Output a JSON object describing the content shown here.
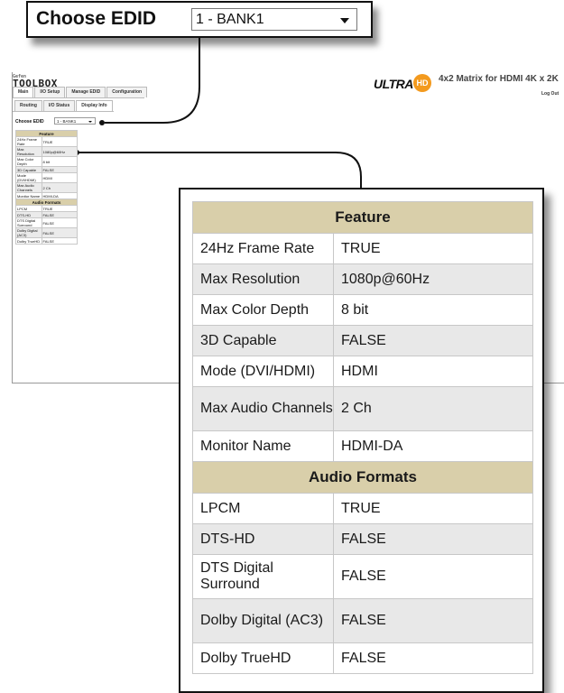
{
  "callout": {
    "label": "Choose EDID",
    "selected": "1 - BANK1"
  },
  "app": {
    "logo_small": "Gefen",
    "logo_main": "TOOLBOX",
    "brand_ultra": "ULTRA",
    "brand_hd": "HD",
    "title": "4x2 Matrix for HDMI 4K x 2K",
    "logout": "Log Out"
  },
  "tabs_main": [
    "Main",
    "I/O Setup",
    "Manage EDID",
    "Configuration"
  ],
  "tabs_sub": [
    "Routing",
    "I/O Status",
    "Display Info"
  ],
  "mini": {
    "choose_label": "Choose EDID",
    "selected": "1 - BANK1"
  },
  "table": {
    "feature_header": "Feature",
    "audio_header": "Audio Formats",
    "features": [
      {
        "key": "24Hz Frame Rate",
        "value": "TRUE"
      },
      {
        "key": "Max Resolution",
        "value": "1080p@60Hz"
      },
      {
        "key": "Max Color Depth",
        "value": "8 bit"
      },
      {
        "key": "3D Capable",
        "value": "FALSE"
      },
      {
        "key": "Mode (DVI/HDMI)",
        "value": "HDMI"
      },
      {
        "key": "Max Audio Channels",
        "value": "2 Ch"
      },
      {
        "key": "Monitor Name",
        "value": "HDMI-DA"
      }
    ],
    "audio": [
      {
        "key": "LPCM",
        "value": "TRUE"
      },
      {
        "key": "DTS-HD",
        "value": "FALSE"
      },
      {
        "key": "DTS Digital Surround",
        "value": "FALSE"
      },
      {
        "key": "Dolby Digital (AC3)",
        "value": "FALSE"
      },
      {
        "key": "Dolby TrueHD",
        "value": "FALSE"
      }
    ]
  },
  "colors": {
    "header_bg": "#d9cfaa",
    "alt_row": "#e8e8e8",
    "hd_badge": "#f39a1e"
  }
}
